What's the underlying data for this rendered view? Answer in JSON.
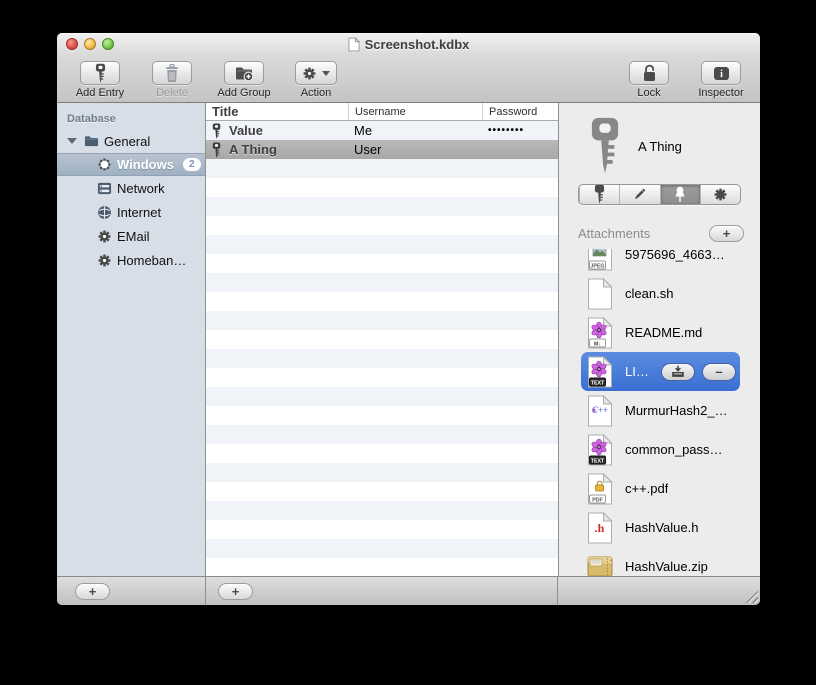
{
  "window": {
    "title": "Screenshot.kdbx"
  },
  "toolbar": {
    "left": [
      {
        "id": "add-entry-button",
        "label": "Add Entry",
        "icon": "key-icon"
      },
      {
        "id": "delete-button",
        "label": "Delete",
        "icon": "trash-icon",
        "disabled": true
      },
      {
        "id": "add-group-button",
        "label": "Add Group",
        "icon": "folder-plus-icon"
      },
      {
        "id": "action-button",
        "label": "Action",
        "icon": "gear-icon",
        "caret": true
      }
    ],
    "right": [
      {
        "id": "lock-button",
        "label": "Lock",
        "icon": "lock-icon"
      },
      {
        "id": "inspector-button",
        "label": "Inspector",
        "icon": "info-icon"
      }
    ]
  },
  "sidebar": {
    "header": "Database",
    "items": [
      {
        "id": "group-general",
        "label": "General",
        "icon": "folder-icon",
        "level": 0,
        "expanded": true
      },
      {
        "id": "group-windows",
        "label": "Windows",
        "icon": "gear-icon",
        "level": 1,
        "badge": "2",
        "selected": true
      },
      {
        "id": "group-network",
        "label": "Network",
        "icon": "network-icon",
        "level": 1
      },
      {
        "id": "group-internet",
        "label": "Internet",
        "icon": "globe-icon",
        "level": 1
      },
      {
        "id": "group-email",
        "label": "EMail",
        "icon": "gear-icon",
        "level": 1
      },
      {
        "id": "group-homebanking",
        "label": "Homeban…",
        "icon": "gear-icon",
        "level": 1
      }
    ],
    "add_button": "+"
  },
  "entries": {
    "columns": {
      "title": "Title",
      "username": "Username",
      "password": "Password"
    },
    "rows": [
      {
        "title": "Value",
        "username": "Me",
        "password": "••••••••"
      },
      {
        "title": "A Thing",
        "username": "User",
        "password": "",
        "selected": true
      }
    ],
    "add_button": "+"
  },
  "inspector": {
    "entry_title": "A Thing",
    "entry_icon": "key-icon",
    "tabs": [
      {
        "id": "tab-general",
        "icon": "key-icon"
      },
      {
        "id": "tab-edit",
        "icon": "pencil-icon"
      },
      {
        "id": "tab-attachments",
        "icon": "pin-icon",
        "selected": true
      },
      {
        "id": "tab-settings",
        "icon": "gear-icon"
      }
    ],
    "attachments": {
      "label": "Attachments",
      "add_button": "+",
      "remove_button": "–",
      "items": [
        {
          "name": "5975696_4663…",
          "icon": "jpeg-file-icon"
        },
        {
          "name": "clean.sh",
          "icon": "sh-file-icon"
        },
        {
          "name": "README.md",
          "icon": "md-file-icon"
        },
        {
          "name": "LI…",
          "icon": "text-file-icon",
          "selected": true
        },
        {
          "name": "MurmurHash2_…",
          "icon": "cpp-file-icon"
        },
        {
          "name": "common_pass…",
          "icon": "text-file-icon"
        },
        {
          "name": "c++.pdf",
          "icon": "pdf-file-icon"
        },
        {
          "name": "HashValue.h",
          "icon": "h-file-icon"
        },
        {
          "name": "HashValue.zip",
          "icon": "zip-file-icon"
        }
      ]
    }
  },
  "colors": {
    "selection_blue": "#4579d9",
    "sidebar_selection": "#a9b9c9",
    "sidebar_bg": "#d7dee7",
    "row_stripe": "#f0f4f9"
  }
}
